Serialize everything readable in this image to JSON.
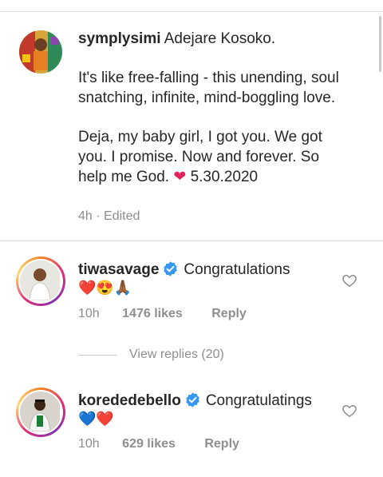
{
  "caption": {
    "username": "symplysimi",
    "lines": [
      "Adejare Kosoko.",
      "It's like free-falling - this unending, soul snatching, infinite, mind-boggling love.",
      "Deja, my baby girl, I got you. We got you. I promise. Now and forever. So help me God.",
      "5.30.2020"
    ],
    "time": "4h · Edited"
  },
  "comments": [
    {
      "username": "tiwasavage",
      "text": "Congratulations",
      "emojis": "❤️😍🙏🏾",
      "time": "10h",
      "likes": "1476 likes",
      "reply": "Reply"
    },
    {
      "username": "korededebello",
      "text": "Congratulatings",
      "emojis": "💙❤️",
      "time": "10h",
      "likes": "629 likes",
      "reply": "Reply"
    }
  ],
  "view_replies": "View replies (20)",
  "colors": {
    "verified": "#3897f0",
    "heart": "#ed4956",
    "meta": "#8e8e8e"
  }
}
